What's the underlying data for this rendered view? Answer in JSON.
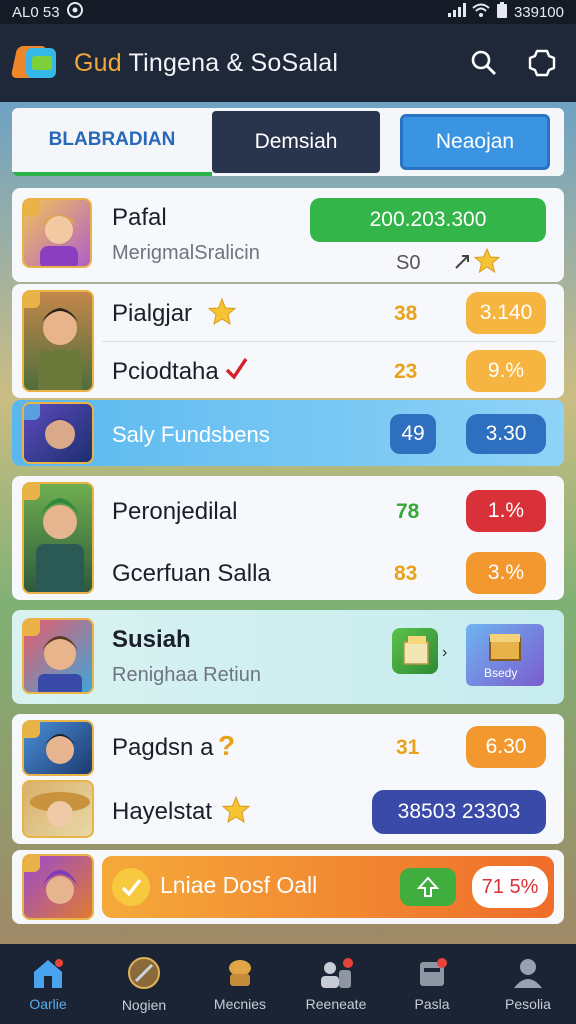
{
  "status": {
    "left": "AL0 53",
    "right": "339100"
  },
  "app": {
    "title_accent": "Gud",
    "title_rest": " Tingena & SoSalal"
  },
  "tabs": [
    {
      "label": "BLABRADIAN"
    },
    {
      "label": "Demsiah"
    },
    {
      "label": "Neaojan"
    }
  ],
  "cards": {
    "c1": {
      "name": "Pafal",
      "sub": "MerigmalSralicin",
      "score": "200.203.300",
      "small": "S0"
    },
    "c2": {
      "name1": "Pialgjar",
      "val1": "38",
      "pill1": "3.140",
      "name2": "Pciodtaha",
      "val2": "23",
      "pill2": "9.%"
    },
    "c3": {
      "name": "Saly Fundsbens",
      "val": "49",
      "pill": "3.30"
    },
    "c4": {
      "name1": "Peronjedilal",
      "val1": "78",
      "pill1": "1.%",
      "name2": "Gcerfuan Salla",
      "val2": "83",
      "pill2": "3.%"
    },
    "c5": {
      "name": "Susiah",
      "sub": "Renighaa Retiun",
      "tile_label": "Bsedy"
    },
    "c6": {
      "name1": "Pagdsn a",
      "val1": "31",
      "pill1": "6.30",
      "name2": "Hayelstat",
      "pill2": "38503 23303"
    },
    "c7": {
      "label": "Lniae Dosf Oall",
      "pct": "71 5%"
    }
  },
  "colors": {
    "green": "#33b54a",
    "orange_pill": "#f6b440",
    "blue_pill": "#2f6fbf",
    "red_pill": "#d9313a",
    "indigo_pill": "#3a4aa8",
    "highlight": "#59b8ef"
  },
  "nav": [
    {
      "label": "Oarlie",
      "icon": "home-icon"
    },
    {
      "label": "Nogien",
      "icon": "compass-icon"
    },
    {
      "label": "Mecnies",
      "icon": "chef-icon"
    },
    {
      "label": "Reeneate",
      "icon": "people-icon"
    },
    {
      "label": "Pasla",
      "icon": "card-icon"
    },
    {
      "label": "Pesolia",
      "icon": "profile-icon"
    }
  ]
}
